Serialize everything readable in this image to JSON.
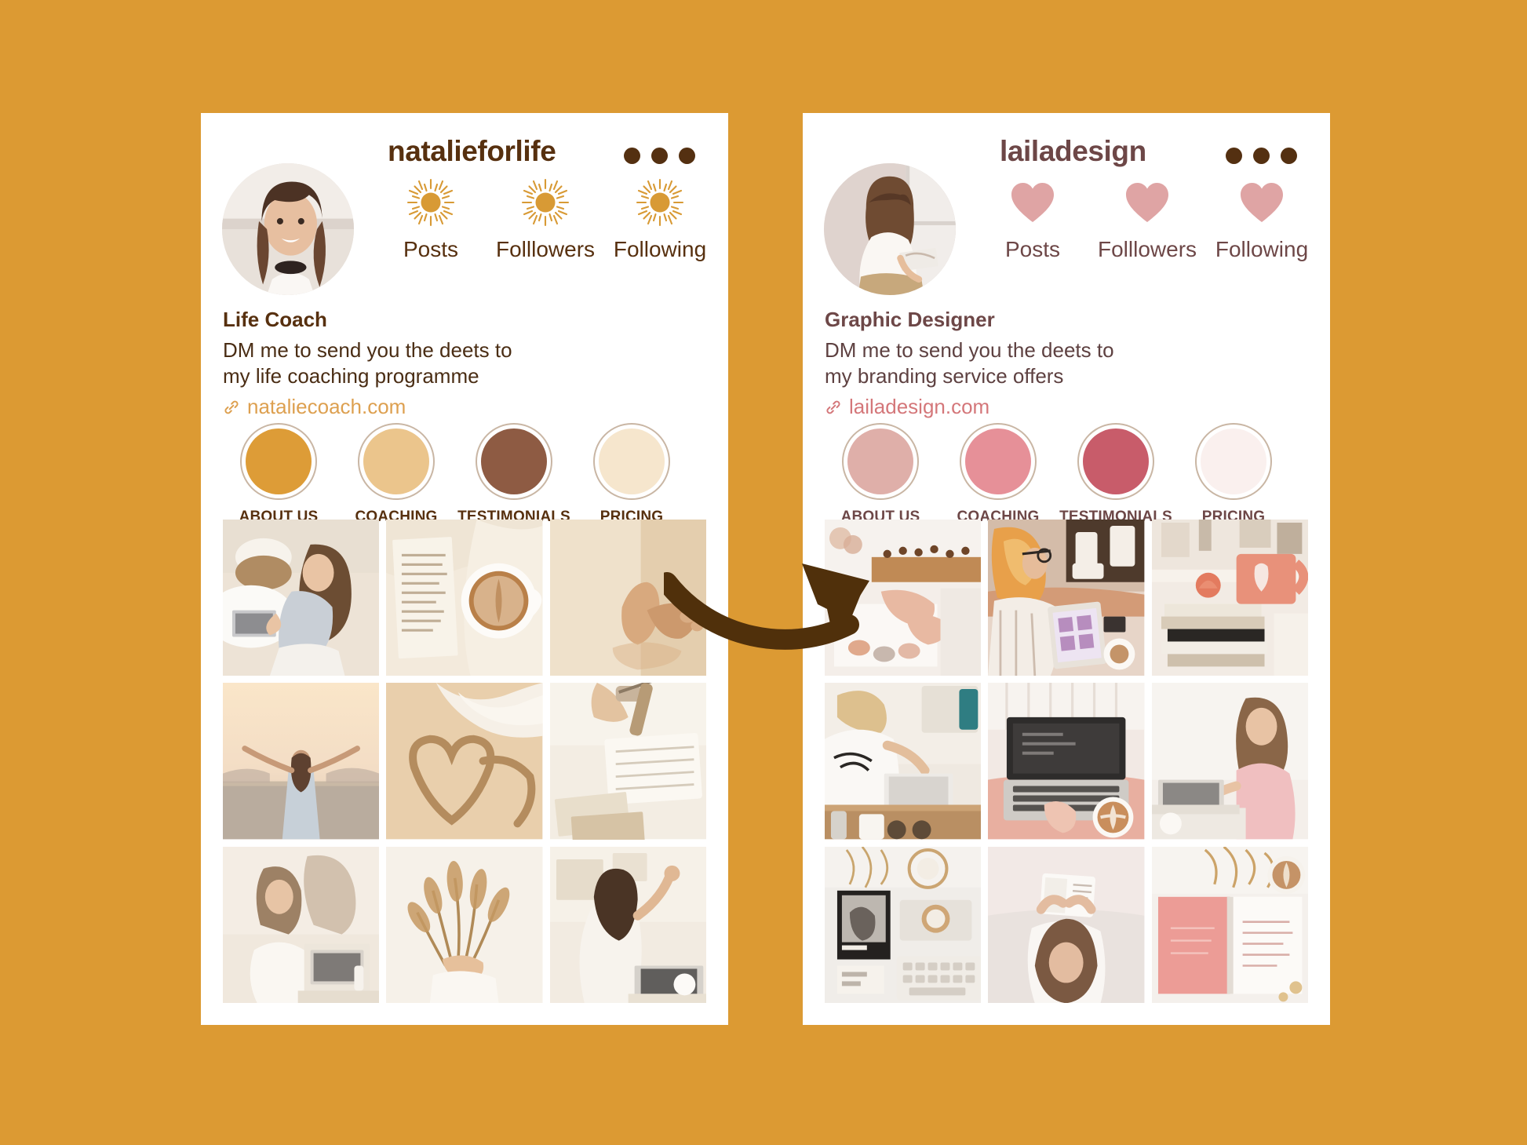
{
  "background_color": "#DC9A33",
  "arrow": {
    "name": "curved-arrow",
    "color": "#50300B",
    "direction": "left-to-right"
  },
  "profiles": [
    {
      "side": "left",
      "handle": "natalieforlife",
      "menu_icon": "three-dots-icon",
      "accent_color": "#D89A35",
      "text_color": "#57300F",
      "link_color": "#DDA050",
      "stat_icon": "sun-icon",
      "stats": [
        {
          "icon": "sun-icon",
          "label": "Posts"
        },
        {
          "icon": "sun-icon",
          "label": "Folllowers"
        },
        {
          "icon": "sun-icon",
          "label": "Following"
        }
      ],
      "bio": {
        "title": "Life Coach",
        "line1": "DM me to send you the deets to",
        "line2": "my life coaching programme",
        "link_icon": "link-icon",
        "link": "nataliecoach.com"
      },
      "highlights": [
        {
          "label": "ABOUT US",
          "color": "#DD9C37"
        },
        {
          "label": "COACHING",
          "color": "#EBC58C"
        },
        {
          "label": "TESTIMONIALS",
          "color": "#8E5B43"
        },
        {
          "label": "PRICING",
          "color": "#F6E6CD"
        }
      ],
      "grid": [
        {
          "name": "woman-laptop-floor",
          "tones": [
            "#EFE6DC",
            "#D8C6B3",
            "#B9A189"
          ]
        },
        {
          "name": "open-book-coffee",
          "tones": [
            "#F2E9DE",
            "#D9BE9B",
            "#BC9468"
          ]
        },
        {
          "name": "bare-feet-sand",
          "tones": [
            "#EFE0CC",
            "#DCC3A2",
            "#C59F74"
          ]
        },
        {
          "name": "woman-arms-open-sea",
          "tones": [
            "#F6E7D4",
            "#E3C9AE",
            "#AFA294"
          ]
        },
        {
          "name": "heart-drawn-in-sand",
          "tones": [
            "#EFD9BA",
            "#DCBE96",
            "#F7F3EC"
          ]
        },
        {
          "name": "notebook-watch-desk",
          "tones": [
            "#F4EDE2",
            "#E0D0BA",
            "#C2AB8E"
          ]
        },
        {
          "name": "woman-white-dress-desk",
          "tones": [
            "#F1E8DD",
            "#DBCBB8",
            "#A88F76"
          ]
        },
        {
          "name": "hand-holding-pampas",
          "tones": [
            "#F5EFE6",
            "#DFCDB4",
            "#B29066"
          ]
        },
        {
          "name": "woman-waving-laptop",
          "tones": [
            "#F2EBE1",
            "#DACBB7",
            "#9E846B"
          ]
        }
      ]
    },
    {
      "side": "right",
      "handle": "lailadesign",
      "menu_icon": "three-dots-icon",
      "accent_color": "#DFA4A4",
      "text_color": "#6D4747",
      "link_color": "#D4777A",
      "stat_icon": "heart-icon",
      "stats": [
        {
          "icon": "heart-icon",
          "label": "Posts"
        },
        {
          "icon": "heart-icon",
          "label": "Folllowers"
        },
        {
          "icon": "heart-icon",
          "label": "Following"
        }
      ],
      "bio": {
        "title": "Graphic Designer",
        "line1": "DM me to send you the deets to",
        "line2": "my branding service offers",
        "link_icon": "link-icon",
        "link": "lailadesign.com"
      },
      "highlights": [
        {
          "label": "ABOUT US",
          "color": "#DFAFA9"
        },
        {
          "label": "COACHING",
          "color": "#E69098"
        },
        {
          "label": "TESTIMONIALS",
          "color": "#C85C6A"
        },
        {
          "label": "PRICING",
          "color": "#FAF0EE"
        }
      ],
      "grid": [
        {
          "name": "designer-hands-colour-swatches",
          "tones": [
            "#F4EEE9",
            "#E2CFC3",
            "#C9A38C"
          ]
        },
        {
          "name": "woman-tablet-cafe",
          "tones": [
            "#F2E6DE",
            "#E0B79C",
            "#C68C6B"
          ]
        },
        {
          "name": "pink-mug-books-stack",
          "tones": [
            "#F4EDE7",
            "#E8A58E",
            "#D0BCA9"
          ]
        },
        {
          "name": "woman-bali-babe-tshirt-laptop",
          "tones": [
            "#F3EDE6",
            "#DED0C0",
            "#A89580"
          ]
        },
        {
          "name": "laptop-lap-latte-overhead",
          "tones": [
            "#F0E6E2",
            "#E7B9A7",
            "#9B9A98"
          ]
        },
        {
          "name": "woman-pink-top-laptop",
          "tones": [
            "#F4EFEA",
            "#E6C1B4",
            "#B79C8B"
          ]
        },
        {
          "name": "pantone-cards-keyboard-flatlay",
          "tones": [
            "#F1EDE9",
            "#D9CBC0",
            "#6E6763"
          ]
        },
        {
          "name": "woman-reading-bed-overhead",
          "tones": [
            "#F2E8E6",
            "#DFB6AD",
            "#B5A098"
          ]
        },
        {
          "name": "open-pink-notebook-coffee",
          "tones": [
            "#F4EEEA",
            "#E9A89B",
            "#CBB6A7"
          ]
        }
      ]
    }
  ]
}
